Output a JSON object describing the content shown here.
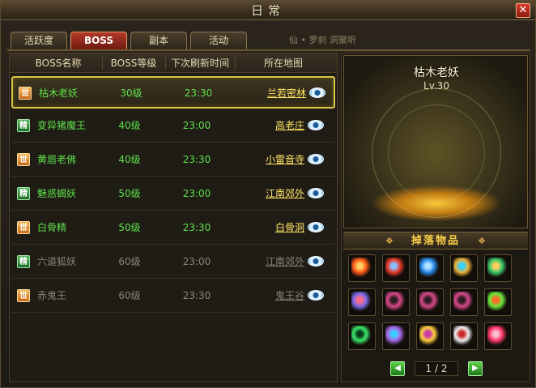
{
  "window": {
    "title": "日常",
    "close_label": "✕"
  },
  "tabs": [
    {
      "label": "活跃度",
      "active": false
    },
    {
      "label": "BOSS",
      "active": true
    },
    {
      "label": "副本",
      "active": false
    },
    {
      "label": "活动",
      "active": false
    }
  ],
  "hint": "仙 • 罗刹 洞聚听",
  "table": {
    "columns": [
      "BOSS名称",
      "BOSS等级",
      "下次刷新时间",
      "所在地图"
    ],
    "rows": [
      {
        "badge": "世",
        "type": "world",
        "name": "枯木老妖",
        "level": "30级",
        "time": "23:30",
        "map": "兰若密林",
        "state": "active",
        "selected": true
      },
      {
        "badge": "精",
        "type": "elite",
        "name": "变异猪魔王",
        "level": "40级",
        "time": "23:00",
        "map": "高老庄",
        "state": "active",
        "selected": false
      },
      {
        "badge": "世",
        "type": "world",
        "name": "黄眉老佛",
        "level": "40级",
        "time": "23:30",
        "map": "小雷音寺",
        "state": "active",
        "selected": false
      },
      {
        "badge": "精",
        "type": "elite",
        "name": "魅惑蝎妖",
        "level": "50级",
        "time": "23:00",
        "map": "江南郊外",
        "state": "active",
        "selected": false
      },
      {
        "badge": "世",
        "type": "world",
        "name": "白骨精",
        "level": "50级",
        "time": "23:30",
        "map": "白骨洞",
        "state": "active",
        "selected": false
      },
      {
        "badge": "精",
        "type": "elite",
        "name": "六道狐妖",
        "level": "60级",
        "time": "23:00",
        "map": "江南郊外",
        "state": "locked",
        "selected": false
      },
      {
        "badge": "世",
        "type": "world",
        "name": "赤鬼王",
        "level": "60级",
        "time": "23:30",
        "map": "鬼王谷",
        "state": "locked",
        "selected": false
      }
    ]
  },
  "boss": {
    "name": "枯木老妖",
    "level": "Lv.30"
  },
  "drops": {
    "title": "掉落物品",
    "items": [
      {
        "icon": "fire-blade-icon",
        "colors": [
          "#ff5a1a",
          "#ffd060"
        ]
      },
      {
        "icon": "red-spear-icon",
        "colors": [
          "#e83a2a",
          "#8ac0ff"
        ]
      },
      {
        "icon": "feather-fan-icon",
        "colors": [
          "#2a8ae8",
          "#aee4ff"
        ]
      },
      {
        "icon": "golden-halberd-icon",
        "colors": [
          "#e8b03a",
          "#3ad0ff"
        ]
      },
      {
        "icon": "green-staff-icon",
        "colors": [
          "#3ac86a",
          "#ffd060"
        ]
      },
      {
        "icon": "serpent-blade-icon",
        "colors": [
          "#7a6ae8",
          "#ff6a8a"
        ]
      },
      {
        "icon": "necklace-icon",
        "colors": [
          "#d84a8a",
          "#2a1a22"
        ]
      },
      {
        "icon": "necklace-icon",
        "colors": [
          "#d84a8a",
          "#2a1a22"
        ]
      },
      {
        "icon": "necklace-icon",
        "colors": [
          "#d84a8a",
          "#2a1a22"
        ]
      },
      {
        "icon": "emerald-charm-icon",
        "colors": [
          "#6ae83a",
          "#ff6a2a"
        ]
      },
      {
        "icon": "jade-bracelet-icon",
        "colors": [
          "#3ae86a",
          "#0a3a1a"
        ]
      },
      {
        "icon": "crystal-shard-icon",
        "colors": [
          "#a86ae8",
          "#3ad0ff"
        ]
      },
      {
        "icon": "gold-beads-icon",
        "colors": [
          "#ffd040",
          "#c83aa8"
        ]
      },
      {
        "icon": "white-mask-icon",
        "colors": [
          "#f0f0f0",
          "#c82a2a"
        ]
      },
      {
        "icon": "red-gem-icon",
        "colors": [
          "#ff3a6a",
          "#ffc0d0"
        ]
      }
    ]
  },
  "pager": {
    "text": "1 / 2",
    "prev": "◀",
    "next": "▶"
  },
  "colors": {
    "accent": "#b33a28",
    "active_text": "#5fe04a",
    "map_text": "#ffe566",
    "locked_text": "#8a8578",
    "highlight": "#d9c44a"
  }
}
